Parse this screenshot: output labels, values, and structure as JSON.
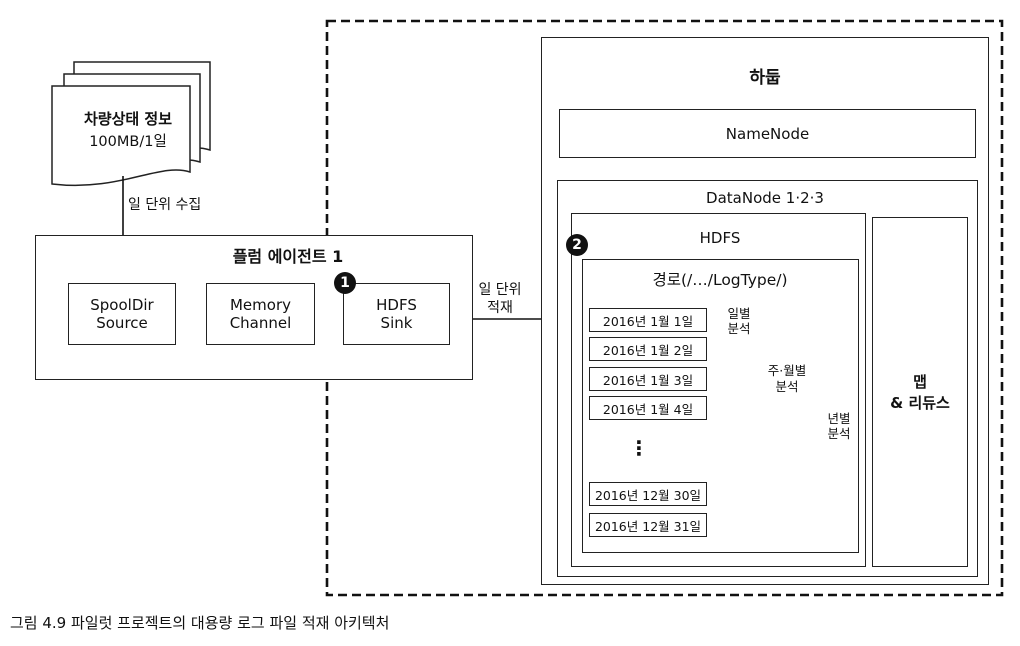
{
  "document": {
    "label": "차량상태 정보",
    "size": "100MB/1일"
  },
  "collect_label": "일 단위 수집",
  "flume": {
    "title": "플럼 에이전트 1",
    "source_line1": "SpoolDir",
    "source_line2": "Source",
    "channel_line1": "Memory",
    "channel_line2": "Channel",
    "sink_line1": "HDFS",
    "sink_line2": "Sink"
  },
  "load_label_line1": "일 단위",
  "load_label_line2": "적재",
  "markers": {
    "one": "1",
    "two": "2"
  },
  "hadoop": {
    "title": "하둡",
    "namenode": "NameNode",
    "datanode": "DataNode 1·2·3",
    "hdfs": "HDFS",
    "path": "경로(/…/LogType/)",
    "days": [
      "2016년 1월 1일",
      "2016년 1월 2일",
      "2016년 1월 3일",
      "2016년 1월 4일",
      "2016년 12월 30일",
      "2016년 12월 31일"
    ],
    "ellipsis": "⋮",
    "daily_line1": "일별",
    "daily_line2": "분석",
    "weekly_line1": "주·월별",
    "weekly_line2": "분석",
    "yearly_line1": "년별",
    "yearly_line2": "분석",
    "mapreduce_line1": "맵",
    "mapreduce_line2": "& 리듀스"
  },
  "caption": "그림 4.9 파일럿 프로젝트의 대용량 로그 파일 적재 아키텍처"
}
